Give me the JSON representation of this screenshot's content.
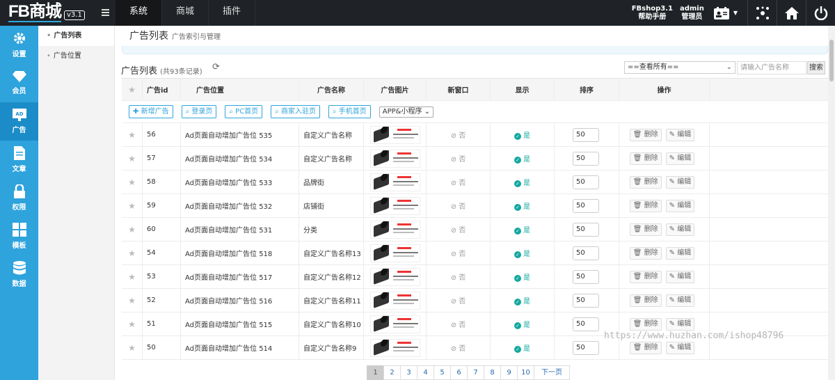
{
  "brand": {
    "logo": "FB商城",
    "version": "v3.1"
  },
  "topnav": [
    {
      "label": "系统"
    },
    {
      "label": "商城"
    },
    {
      "label": "插件"
    }
  ],
  "topright": {
    "shop_version": "FBshop3.1",
    "help": "帮助手册",
    "user": "admin",
    "role": "管理员"
  },
  "sidebar": [
    {
      "label": "设置",
      "icon": "gear-icon"
    },
    {
      "label": "会员",
      "icon": "diamond-icon"
    },
    {
      "label": "广告",
      "icon": "ad-icon"
    },
    {
      "label": "文章",
      "icon": "document-icon"
    },
    {
      "label": "权限",
      "icon": "lock-icon"
    },
    {
      "label": "模板",
      "icon": "grid-icon"
    },
    {
      "label": "数据",
      "icon": "database-icon"
    }
  ],
  "submenu": [
    {
      "label": "广告列表"
    },
    {
      "label": "广告位置"
    }
  ],
  "page": {
    "title": "广告列表",
    "subtitle": "广告索引与管理"
  },
  "list": {
    "title": "广告列表",
    "count": "(共93条记录)",
    "filter_value": "==查看所有==",
    "search_placeholder": "请输入广告名称",
    "search_button": "搜索"
  },
  "columns": [
    "广告id",
    "广告位置",
    "广告名称",
    "广告图片",
    "新窗口",
    "显示",
    "排序",
    "操作"
  ],
  "toolbar": {
    "add": "新增广告",
    "filters": [
      "登录页",
      "PC首页",
      "商家入驻页",
      "手机首页"
    ],
    "select": "APP&小程序"
  },
  "rows": [
    {
      "id": "56",
      "position": "Ad页面自动增加广告位 535",
      "name": "自定义广告名称",
      "new_window": "否",
      "show": "是",
      "sort": "50"
    },
    {
      "id": "57",
      "position": "Ad页面自动增加广告位 534",
      "name": "自定义广告名称",
      "new_window": "否",
      "show": "是",
      "sort": "50"
    },
    {
      "id": "58",
      "position": "Ad页面自动增加广告位 533",
      "name": "品牌街",
      "new_window": "否",
      "show": "是",
      "sort": "50"
    },
    {
      "id": "59",
      "position": "Ad页面自动增加广告位 532",
      "name": "店铺街",
      "new_window": "否",
      "show": "是",
      "sort": "50"
    },
    {
      "id": "60",
      "position": "Ad页面自动增加广告位 531",
      "name": "分类",
      "new_window": "否",
      "show": "是",
      "sort": "50"
    },
    {
      "id": "54",
      "position": "Ad页面自动增加广告位 518",
      "name": "自定义广告名称13",
      "new_window": "否",
      "show": "是",
      "sort": "50"
    },
    {
      "id": "53",
      "position": "Ad页面自动增加广告位 517",
      "name": "自定义广告名称12",
      "new_window": "否",
      "show": "是",
      "sort": "50"
    },
    {
      "id": "52",
      "position": "Ad页面自动增加广告位 516",
      "name": "自定义广告名称11",
      "new_window": "否",
      "show": "是",
      "sort": "50"
    },
    {
      "id": "51",
      "position": "Ad页面自动增加广告位 515",
      "name": "自定义广告名称10",
      "new_window": "否",
      "show": "是",
      "sort": "50"
    },
    {
      "id": "50",
      "position": "Ad页面自动增加广告位 514",
      "name": "自定义广告名称9",
      "new_window": "否",
      "show": "是",
      "sort": "50"
    }
  ],
  "actions": {
    "delete": "删除",
    "edit": "编辑"
  },
  "pager": [
    "1",
    "2",
    "3",
    "4",
    "5",
    "6",
    "7",
    "8",
    "9",
    "10",
    "下一页"
  ],
  "watermark": "https://www.huzhan.com/ishop48796",
  "colors": {
    "sidebar": "#2ea3dc",
    "topbar": "#1f2327",
    "accent": "#13a89e"
  }
}
